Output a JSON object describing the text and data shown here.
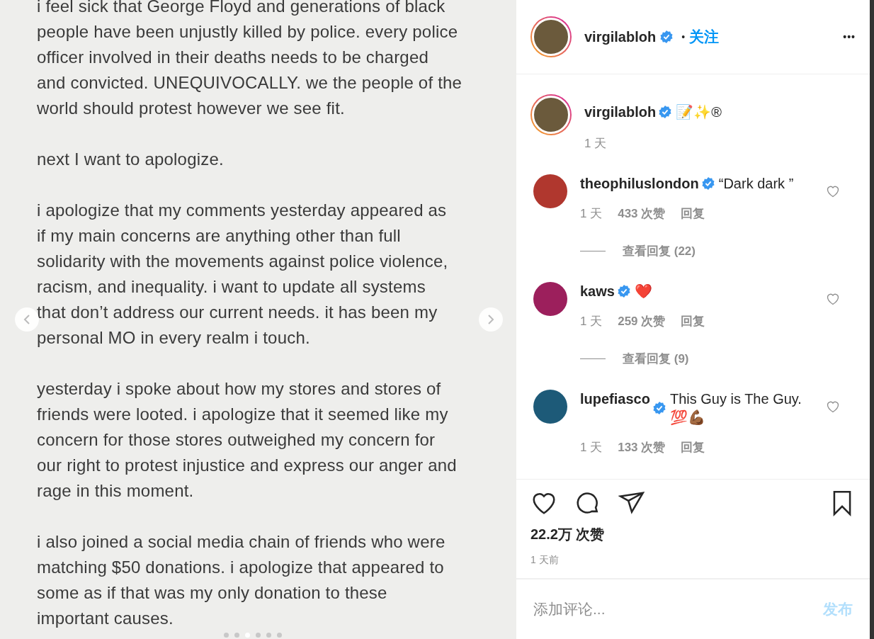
{
  "post_image": {
    "paragraphs": [
      [
        "i feel sick that George Floyd and generations of black",
        "people have been unjustly killed by police. every police",
        "officer involved in their deaths needs to be charged",
        "and convicted. UNEQUIVOCALLY. we the people of the",
        "world should protest however we see fit."
      ],
      [
        "next I want to apologize."
      ],
      [
        "i apologize that my comments yesterday appeared as",
        "if my main concerns are anything other than full",
        "solidarity with the movements against police violence,",
        "racism, and inequality. i want to update all systems",
        "that don’t address our current needs. it has been my",
        "personal MO in every realm i touch."
      ],
      [
        "yesterday i spoke about how my stores and stores of",
        "friends were looted. i apologize that it seemed like my",
        "concern for those stores outweighed my concern for",
        "our right to protest injustice and express our anger and",
        "rage in this moment."
      ],
      [
        "i also joined a social media chain of friends who were",
        "matching $50 donations. i apologize that appeared to",
        "some as if that was my only donation to these",
        "important causes."
      ]
    ],
    "dots": [
      {
        "selected": false
      },
      {
        "selected": false
      },
      {
        "selected": true
      },
      {
        "selected": false
      },
      {
        "selected": false
      },
      {
        "selected": false
      }
    ]
  },
  "header": {
    "username": "virgilabloh",
    "verified": true,
    "separator": "•",
    "follow": "关注",
    "more": "•••"
  },
  "caption": {
    "username": "virgilabloh",
    "verified": true,
    "text": "📝✨®",
    "time": "1 天"
  },
  "comments": [
    {
      "username": "theophiluslondon",
      "verified": true,
      "text": "“Dark dark ”",
      "time": "1 天",
      "likes": "433 次赞",
      "reply": "回复",
      "view_replies": "查看回复 (22)"
    },
    {
      "username": "kaws",
      "verified": true,
      "text": "❤️",
      "time": "1 天",
      "likes": "259 次赞",
      "reply": "回复",
      "view_replies": "查看回复 (9)"
    },
    {
      "username": "lupefiasco",
      "verified": true,
      "text": "This Guy is The Guy. 💯💪🏾",
      "time": "1 天",
      "likes": "133 次赞",
      "reply": "回复"
    }
  ],
  "likes_count": "22.2万 次赞",
  "posted": "1 天前",
  "comment_box": {
    "placeholder": "添加评论...",
    "post": "发布"
  }
}
